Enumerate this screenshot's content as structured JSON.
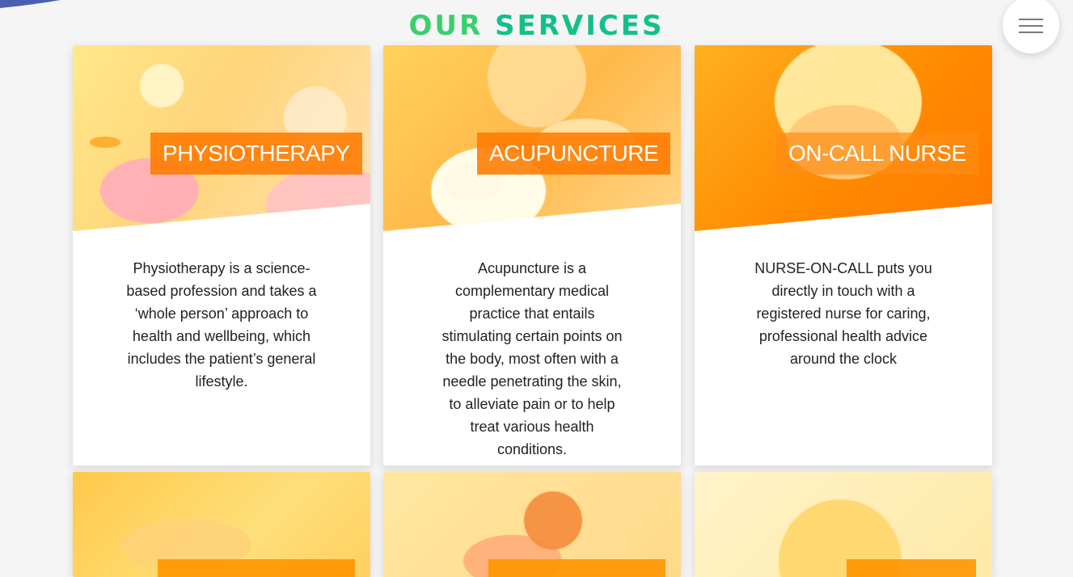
{
  "page": {
    "title_word1": "OUR",
    "title_word2": "SERVICES"
  },
  "colors": {
    "title_green": "#3ccf6e",
    "title_teal": "#14c08a",
    "label_orange": "#ff7a00",
    "background": "#f5f5f5"
  },
  "menu": {
    "icon": "hamburger-menu-icon"
  },
  "services": [
    {
      "label": "PHYSIOTHERAPY",
      "description": "Physiotherapy is a science-based profession and takes a ‘whole person’ approach to health and wellbeing, which includes the patient’s general lifestyle."
    },
    {
      "label": "ACUPUNCTURE",
      "description": "Acupuncture is a complementary medical practice that entails stimulating certain points on the body, most often with a needle penetrating the skin, to alleviate pain or to help treat various health conditions."
    },
    {
      "label": "ON-CALL NURSE",
      "description": "NURSE-ON-CALL puts you directly in touch with a registered nurse for caring, professional health advice around the clock"
    }
  ]
}
